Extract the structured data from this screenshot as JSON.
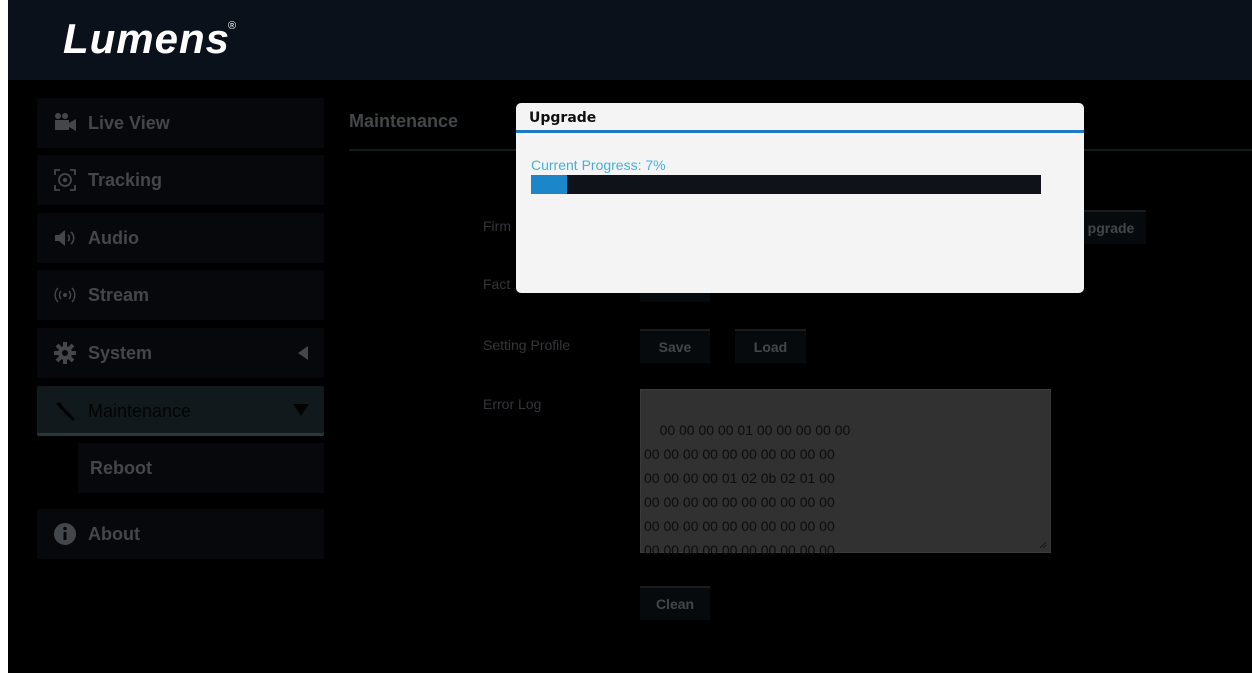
{
  "brand": {
    "logo": "Lumens",
    "registered": "®"
  },
  "sidebar": {
    "items": [
      {
        "label": "Live View"
      },
      {
        "label": "Tracking"
      },
      {
        "label": "Audio"
      },
      {
        "label": "Stream"
      },
      {
        "label": "System"
      },
      {
        "label": "Maintenance"
      },
      {
        "label": "Reboot"
      },
      {
        "label": "About"
      }
    ]
  },
  "main": {
    "title": "Maintenance",
    "firmware_label_visible": "Firm",
    "factory_label_visible": "Fact",
    "upgrade_button_visible": "pgrade",
    "setting_profile_label": "Setting Profile",
    "save_label": "Save",
    "load_label": "Load",
    "error_log_label": "Error Log",
    "error_log_text": "00 00 00 00 01 00 00 00 00 00\n00 00 00 00 00 00 00 00 00 00\n00 00 00 00 01 02 0b 02 01 00\n00 00 00 00 00 00 00 00 00 00\n00 00 00 00 00 00 00 00 00 00\n00 00 00 00 00 00 00 00 00 00",
    "clean_label": "Clean"
  },
  "modal": {
    "title": "Upgrade",
    "progress_text": "Current Progress: 7%",
    "progress_percent": 7
  },
  "colors": {
    "accent": "#1f78c2",
    "progress_fill": "#1b86c9",
    "progress_text": "#47b0d9",
    "menu_text": "#7b8087"
  }
}
